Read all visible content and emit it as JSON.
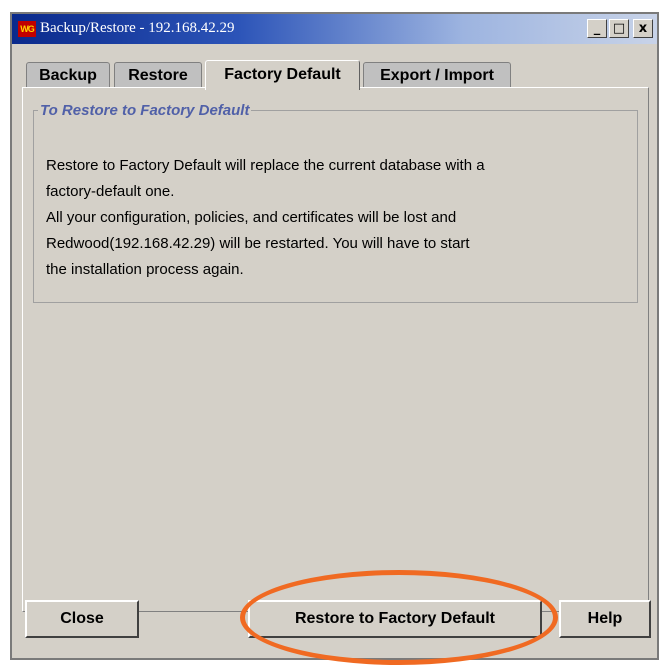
{
  "window": {
    "title": "Backup/Restore - 192.168.42.29",
    "logo_text": "WG",
    "controls": {
      "minimize": "_",
      "maximize": "□",
      "close": "x"
    }
  },
  "tabs": [
    {
      "label": "Backup",
      "active": false
    },
    {
      "label": "Restore",
      "active": false
    },
    {
      "label": "Factory Default",
      "active": true
    },
    {
      "label": "Export / Import",
      "active": false
    }
  ],
  "group": {
    "title": "To Restore to Factory Default",
    "lines": [
      "Restore to Factory Default will replace the current database with a",
      "factory-default one.",
      "All your configuration, policies, and certificates will be lost and",
      "Redwood(192.168.42.29) will be restarted. You will have to start",
      "the installation process again."
    ]
  },
  "buttons": {
    "close": "Close",
    "restore": "Restore to Factory Default",
    "help": "Help"
  },
  "colors": {
    "highlight": "#f06a22",
    "group_title": "#5060a8",
    "titlebar_start": "#0a2a8c",
    "panel": "#d4d0c8"
  }
}
